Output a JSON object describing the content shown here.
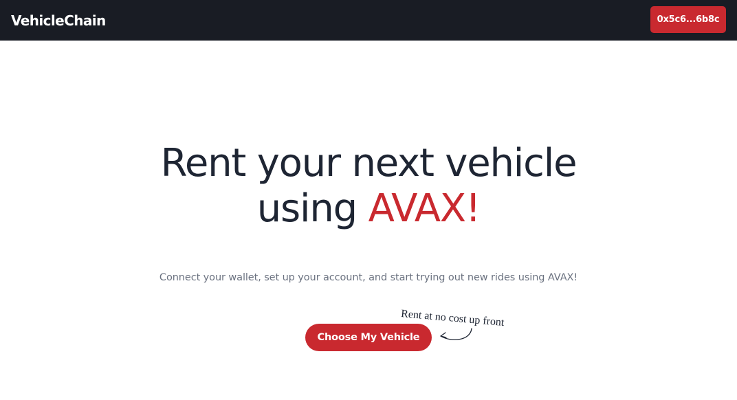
{
  "navbar": {
    "brand": "VehicleChain",
    "wallet_label": "0x5c6...6b8c",
    "background": "#191c24",
    "accent": "#c9292f"
  },
  "hero": {
    "title_line1": "Rent your next vehicle",
    "title_line2_prefix": "using ",
    "title_line2_accent": "AVAX!",
    "subtitle": "Connect your wallet, set up your account, and start trying out new rides using AVAX!",
    "cta_label": "Choose My Vehicle",
    "note": "Rent at no cost up front",
    "note_icon": "curved-arrow-icon"
  },
  "colors": {
    "title": "#1e2533",
    "subtitle": "#6b7280",
    "accent": "#c9292f"
  }
}
